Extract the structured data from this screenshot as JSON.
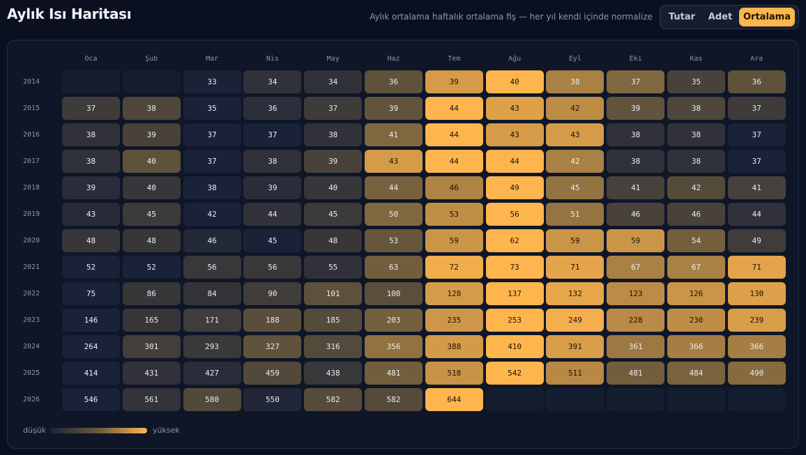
{
  "header": {
    "title": "Aylık Isı Haritası",
    "subtitle": "Aylık ortalama haftalık ortalama fiş — her yıl kendi içinde normalize",
    "modes": [
      "Tutar",
      "Adet",
      "Ortalama"
    ],
    "active_mode": "Ortalama"
  },
  "heatmap": {
    "months": [
      "Oca",
      "Şub",
      "Mar",
      "Nis",
      "May",
      "Haz",
      "Tem",
      "Ağu",
      "Eyl",
      "Eki",
      "Kas",
      "Ara"
    ],
    "rows": [
      {
        "year": "2014",
        "values": [
          null,
          null,
          33,
          34,
          34,
          36,
          39,
          40,
          38,
          37,
          35,
          36
        ]
      },
      {
        "year": "2015",
        "values": [
          37,
          38,
          35,
          36,
          37,
          39,
          44,
          43,
          42,
          39,
          38,
          37
        ]
      },
      {
        "year": "2016",
        "values": [
          38,
          39,
          37,
          37,
          38,
          41,
          44,
          43,
          43,
          38,
          38,
          37
        ]
      },
      {
        "year": "2017",
        "values": [
          38,
          40,
          37,
          38,
          39,
          43,
          44,
          44,
          42,
          38,
          38,
          37
        ]
      },
      {
        "year": "2018",
        "values": [
          39,
          40,
          38,
          39,
          40,
          44,
          46,
          49,
          45,
          41,
          42,
          41
        ]
      },
      {
        "year": "2019",
        "values": [
          43,
          45,
          42,
          44,
          45,
          50,
          53,
          56,
          51,
          46,
          46,
          44
        ]
      },
      {
        "year": "2020",
        "values": [
          48,
          48,
          46,
          45,
          48,
          53,
          59,
          62,
          59,
          59,
          54,
          49
        ]
      },
      {
        "year": "2021",
        "values": [
          52,
          52,
          56,
          56,
          55,
          63,
          72,
          73,
          71,
          67,
          67,
          71
        ]
      },
      {
        "year": "2022",
        "values": [
          75,
          86,
          84,
          90,
          101,
          100,
          128,
          137,
          132,
          123,
          126,
          130
        ]
      },
      {
        "year": "2023",
        "values": [
          146,
          165,
          171,
          188,
          185,
          203,
          235,
          253,
          249,
          228,
          230,
          239
        ]
      },
      {
        "year": "2024",
        "values": [
          264,
          301,
          293,
          327,
          316,
          356,
          388,
          410,
          391,
          361,
          366,
          366
        ]
      },
      {
        "year": "2025",
        "values": [
          414,
          431,
          427,
          459,
          438,
          481,
          518,
          542,
          511,
          481,
          484,
          490
        ]
      },
      {
        "year": "2026",
        "values": [
          546,
          561,
          580,
          550,
          582,
          582,
          644,
          null,
          null,
          null,
          null,
          null
        ]
      }
    ]
  },
  "legend": {
    "low": "düşük",
    "high": "yüksek"
  },
  "colors": {
    "low": "#1a2238",
    "mid": "#6b5a3c",
    "high": "#ffb54e",
    "empty": "#151d31",
    "accent": "#ffb54e"
  }
}
